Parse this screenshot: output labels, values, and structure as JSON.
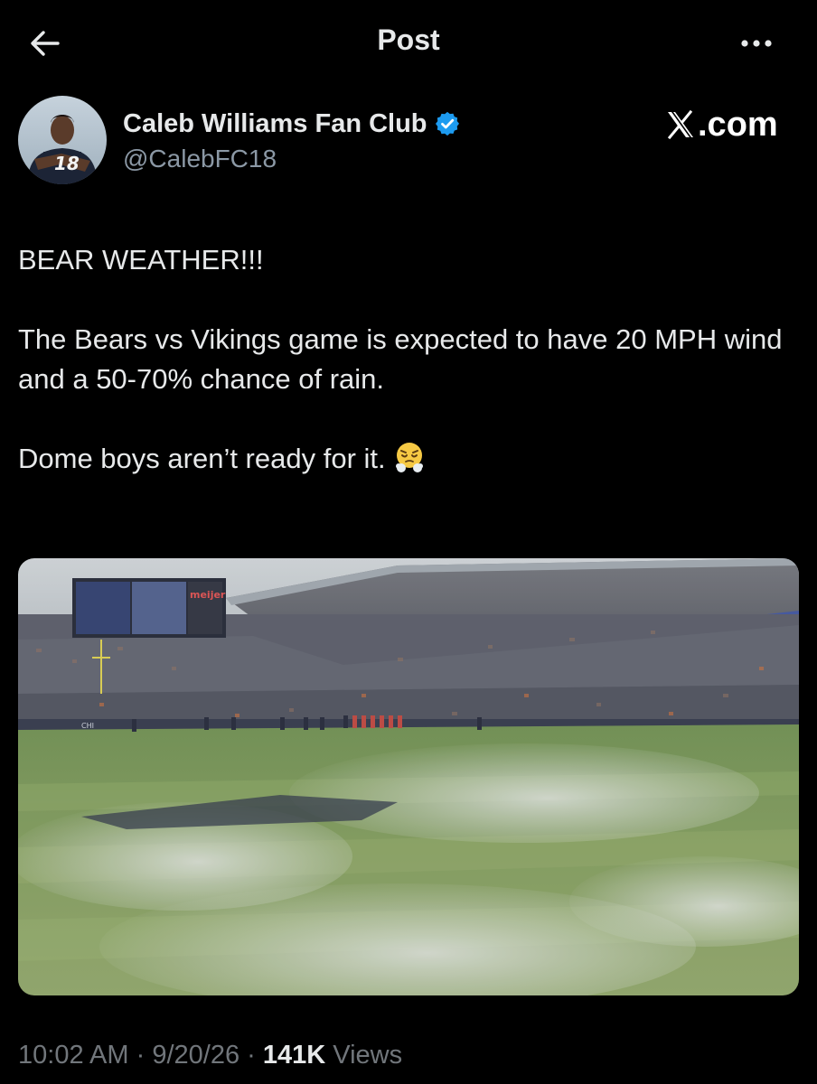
{
  "header": {
    "title": "Post",
    "back_icon": "arrow-left-icon",
    "more_icon": "more-horizontal-icon"
  },
  "author": {
    "name": "Caleb Williams Fan Club",
    "handle": "@CalebFC18",
    "verified": true,
    "avatar_jersey_number": "18"
  },
  "brand": {
    "label": ".com"
  },
  "tweet": {
    "line1": "BEAR WEATHER!!!",
    "line2": "The Bears vs Vikings game is expected to have 20 MPH wind and a 50-70% chance of rain.",
    "line3": "Dome boys aren’t ready for it.",
    "emoji": "face-with-steam-from-nose"
  },
  "photo": {
    "scoreboard_text": "meijer",
    "stadium_text": "CHI"
  },
  "meta": {
    "time": "10:02 AM",
    "separator": "·",
    "date": "9/20/26",
    "views_count": "141K",
    "views_label": "Views"
  },
  "colors": {
    "background": "#000000",
    "text_primary": "#e7e9ea",
    "text_secondary": "#71767b",
    "handle": "#8b98a5",
    "verified_blue": "#1d9bf0"
  }
}
